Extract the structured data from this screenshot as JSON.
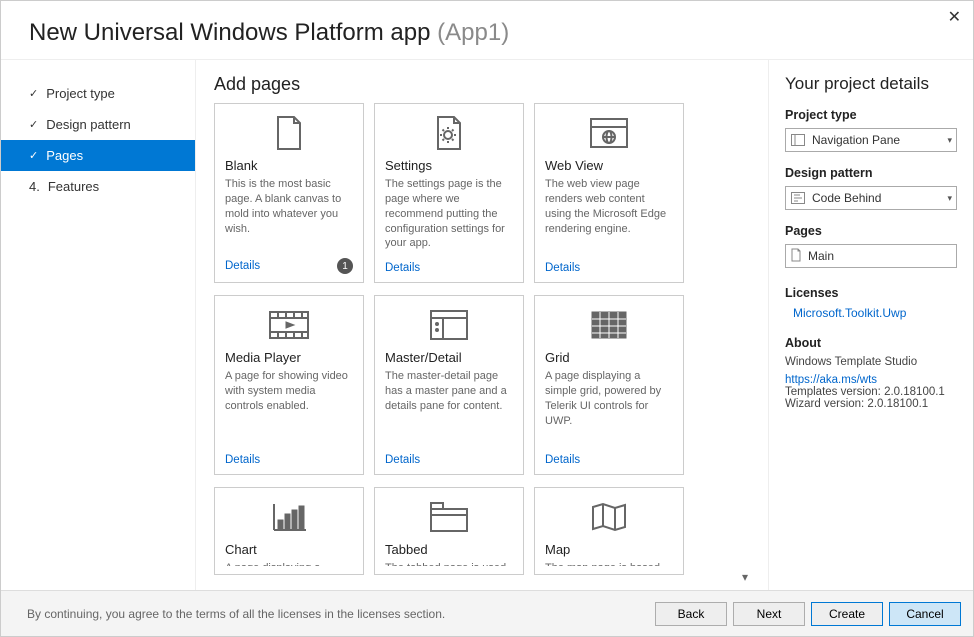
{
  "header": {
    "title": "New Universal Windows Platform app",
    "project_name": "(App1)"
  },
  "sidebar": {
    "steps": [
      {
        "label": "Project type",
        "done": true
      },
      {
        "label": "Design pattern",
        "done": true
      },
      {
        "label": "Pages",
        "active": true
      },
      {
        "label": "Features",
        "num": "4."
      }
    ]
  },
  "main": {
    "title": "Add pages",
    "details_label": "Details",
    "cards": [
      {
        "icon": "blank",
        "title": "Blank",
        "desc": "This is the most basic page. A blank canvas to mold into whatever you wish.",
        "badge": "1"
      },
      {
        "icon": "settings",
        "title": "Settings",
        "desc": "The settings page is the page where we recommend putting the configuration settings for your app."
      },
      {
        "icon": "webview",
        "title": "Web View",
        "desc": "The web view page renders web content using the Microsoft Edge rendering engine."
      },
      {
        "icon": "media",
        "title": "Media Player",
        "desc": "A page for showing video with system media controls enabled."
      },
      {
        "icon": "masterdetail",
        "title": "Master/Detail",
        "desc": "The master-detail page has a master pane and a details pane for content."
      },
      {
        "icon": "grid",
        "title": "Grid",
        "desc": "A page displaying a simple grid, powered by Telerik UI controls for UWP."
      },
      {
        "icon": "chart",
        "title": "Chart",
        "desc": "A page displaying a"
      },
      {
        "icon": "tabbed",
        "title": "Tabbed",
        "desc": "The tabbed page is used"
      },
      {
        "icon": "map",
        "title": "Map",
        "desc": "The map page is based"
      }
    ]
  },
  "details": {
    "title": "Your project details",
    "project_type_label": "Project type",
    "project_type_value": "Navigation Pane",
    "design_pattern_label": "Design pattern",
    "design_pattern_value": "Code Behind",
    "pages_label": "Pages",
    "pages_value": "Main",
    "licenses_label": "Licenses",
    "license_link": "Microsoft.Toolkit.Uwp",
    "about_label": "About",
    "about_text": "Windows Template Studio",
    "about_link": "https://aka.ms/wts",
    "templates_version": "Templates version: 2.0.18100.1",
    "wizard_version": "Wizard version: 2.0.18100.1"
  },
  "footer": {
    "text": "By continuing, you agree to the terms of all the licenses in the licenses section.",
    "back": "Back",
    "next": "Next",
    "create": "Create",
    "cancel": "Cancel"
  }
}
